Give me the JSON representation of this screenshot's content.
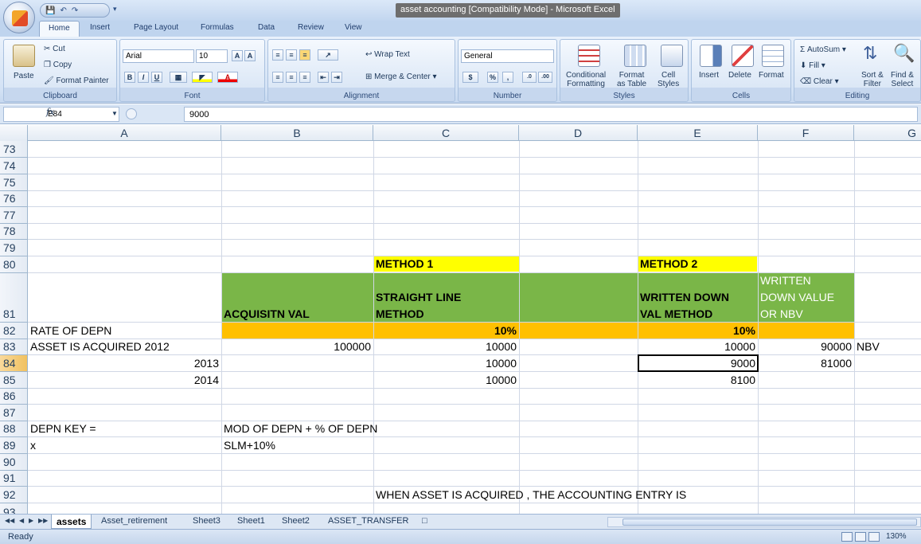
{
  "window": {
    "title": "asset accounting  [Compatibility Mode] - Microsoft Excel"
  },
  "ribbon": {
    "tabs": [
      "Home",
      "Insert",
      "Page Layout",
      "Formulas",
      "Data",
      "Review",
      "View"
    ],
    "clipboard": {
      "paste": "Paste",
      "cut": "Cut",
      "copy": "Copy",
      "format_painter": "Format Painter",
      "label": "Clipboard"
    },
    "font": {
      "name": "Arial",
      "size": "10",
      "label": "Font",
      "bold": "B",
      "italic": "I",
      "underline": "U"
    },
    "alignment": {
      "wrap_text": "Wrap Text",
      "merge_center": "Merge & Center",
      "label": "Alignment"
    },
    "number": {
      "format": "General",
      "currency": "$",
      "percent": "%",
      "comma": ",",
      "label": "Number"
    },
    "styles": {
      "conditional_1": "Conditional",
      "conditional_2": "Formatting",
      "format_1": "Format",
      "format_2": "as Table",
      "cell_1": "Cell",
      "cell_2": "Styles",
      "label": "Styles"
    },
    "cells": {
      "insert": "Insert",
      "delete": "Delete",
      "format": "Format",
      "label": "Cells"
    },
    "editing": {
      "autosum": "AutoSum",
      "fill": "Fill",
      "clear": "Clear",
      "sort_1": "Sort &",
      "sort_2": "Filter",
      "find_1": "Find &",
      "find_2": "Select",
      "label": "Editing"
    }
  },
  "formula_bar": {
    "name_box": "E84",
    "fx": "fx",
    "value": "9000"
  },
  "columns": [
    "A",
    "B",
    "C",
    "D",
    "E",
    "F",
    "G"
  ],
  "rows": [
    "73",
    "74",
    "75",
    "76",
    "77",
    "78",
    "79",
    "80",
    "81",
    "82",
    "83",
    "84",
    "85",
    "86",
    "87",
    "88",
    "89",
    "90",
    "91",
    "92",
    "93"
  ],
  "cells": {
    "C80": "METHOD  1",
    "E80": "METHOD 2",
    "B81": "ACQUISITN VAL",
    "C81_1": "STRAIGHT LINE",
    "C81_2": "METHOD",
    "E81_1": "WRITTEN DOWN",
    "E81_2": "VAL METHOD",
    "F81_1": "WRITTEN",
    "F81_2": "DOWN VALUE",
    "F81_3": "OR NBV",
    "A82": "RATE OF DEPN",
    "C82": "10%",
    "E82": "10%",
    "A83": "ASSET IS ACQUIRED  2012",
    "B83": "100000",
    "C83": "10000",
    "E83": "10000",
    "F83": "90000",
    "G83": "NBV",
    "A84": "2013",
    "C84": "10000",
    "E84": "9000",
    "F84": "81000",
    "A85": "2014",
    "C85": "10000",
    "E85": "8100",
    "A88": "DEPN KEY =",
    "B88": "MOD OF DEPN + % OF DEPN",
    "A89": "x",
    "B89": "SLM+10%",
    "C92": "WHEN ASSET IS ACQUIRED , THE ACCOUNTING  ENTRY IS"
  },
  "sheet_tabs": [
    "assets",
    "Asset_retirement",
    "Sheet3",
    "Sheet1",
    "Sheet2",
    "ASSET_TRANSFER"
  ],
  "status_bar": {
    "status": "Ready",
    "zoom": "130%"
  }
}
